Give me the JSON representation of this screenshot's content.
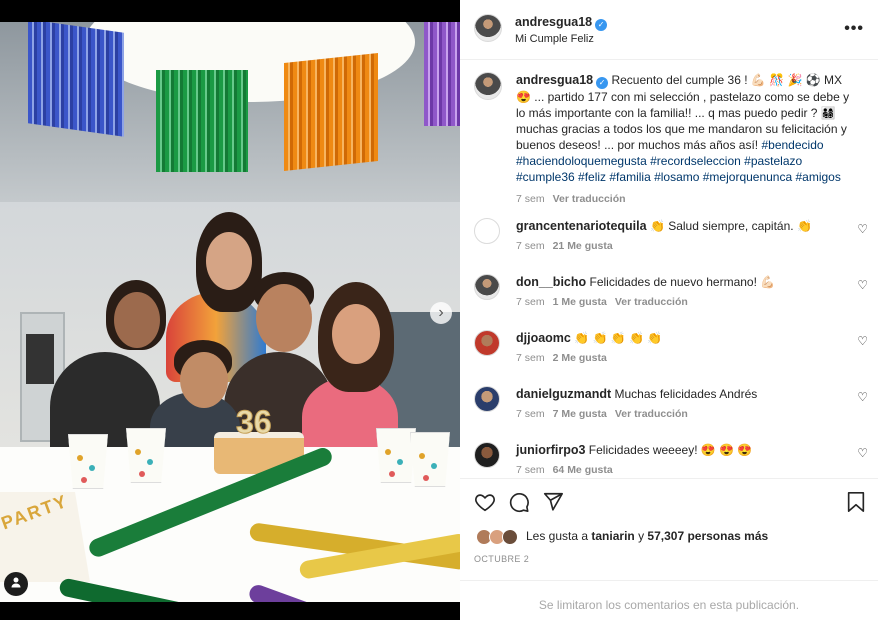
{
  "post": {
    "username": "andresgua18",
    "location": "Mi Cumple Feliz",
    "caption_text": "Recuento del cumple 36 ! 💪🏻 🎊 🎉 ⚽ MX 😍 ... partido 177 con mi selección , pastelazo como se debe y lo más importante con la familia!! ... q mas puedo pedir ? 👨‍👩‍👧‍👦 muchas gracias a todos los que me mandaron su felicitación y buenos deseos! ... por muchos más años así!",
    "hashtags": "#bendecido #haciendoloquemegusta #recordseleccion #pastelazo #cumple36 #feliz #familia #losamo #mejorquenunca #amigos",
    "caption_time": "7 sem",
    "translate_label": "Ver traducción",
    "photo_party_text": "PARTY",
    "cake_candles": "36"
  },
  "comments": [
    {
      "user": "grancentenariotequila",
      "text": "👏 Salud siempre, capitán. 👏",
      "time": "7 sem",
      "likes": "21 Me gusta",
      "translate": ""
    },
    {
      "user": "don__bicho",
      "text": "Felicidades de nuevo hermano! 💪🏻",
      "time": "7 sem",
      "likes": "1 Me gusta",
      "translate": "Ver traducción"
    },
    {
      "user": "djjoaomc",
      "text": "👏 👏 👏 👏 👏",
      "time": "7 sem",
      "likes": "2 Me gusta",
      "translate": ""
    },
    {
      "user": "danielguzmandt",
      "text": "Muchas felicidades Andrés",
      "time": "7 sem",
      "likes": "7 Me gusta",
      "translate": "Ver traducción"
    },
    {
      "user": "juniorfirpo3",
      "text": "Felicidades weeeey! 😍 😍 😍",
      "time": "7 sem",
      "likes": "64 Me gusta",
      "translate": ""
    }
  ],
  "likes": {
    "prefix": "Les gusta a",
    "first_user": "taniarin",
    "joiner": "y",
    "others": "57,307 personas más"
  },
  "date": "OCTUBRE 2",
  "comments_closed": "Se limitaron los comentarios en esta publicación.",
  "icons": {
    "more": "more-options-icon",
    "like": "heart-icon",
    "comment": "comment-icon",
    "share": "paper-plane-icon",
    "save": "bookmark-icon",
    "next": "chevron-right-icon",
    "tag": "user-tag-icon"
  },
  "colors": {
    "link": "#00376b",
    "verified": "#3897f0",
    "muted": "#8e8e8e"
  }
}
